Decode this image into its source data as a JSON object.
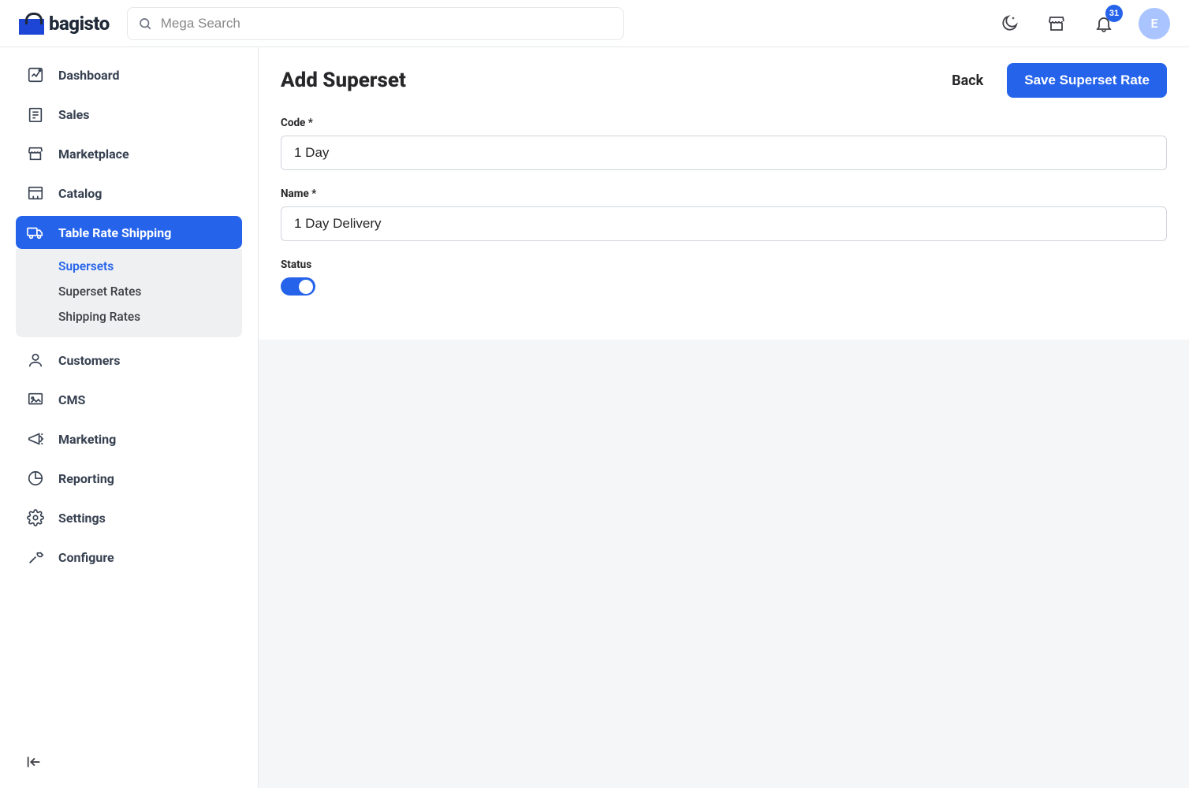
{
  "brand": {
    "name": "bagisto"
  },
  "search": {
    "placeholder": "Mega Search"
  },
  "header": {
    "notification_count": "31",
    "avatar_letter": "E"
  },
  "sidebar": {
    "items": [
      {
        "label": "Dashboard"
      },
      {
        "label": "Sales"
      },
      {
        "label": "Marketplace"
      },
      {
        "label": "Catalog"
      },
      {
        "label": "Table Rate Shipping"
      },
      {
        "label": "Customers"
      },
      {
        "label": "CMS"
      },
      {
        "label": "Marketing"
      },
      {
        "label": "Reporting"
      },
      {
        "label": "Settings"
      },
      {
        "label": "Configure"
      }
    ],
    "sub_items": [
      {
        "label": "Supersets"
      },
      {
        "label": "Superset Rates"
      },
      {
        "label": "Shipping Rates"
      }
    ]
  },
  "page": {
    "title": "Add Superset",
    "back_label": "Back",
    "save_label": "Save Superset Rate",
    "fields": {
      "code_label": "Code *",
      "code_value": "1 Day",
      "name_label": "Name *",
      "name_value": "1 Day Delivery",
      "status_label": "Status",
      "status_on": true
    }
  }
}
